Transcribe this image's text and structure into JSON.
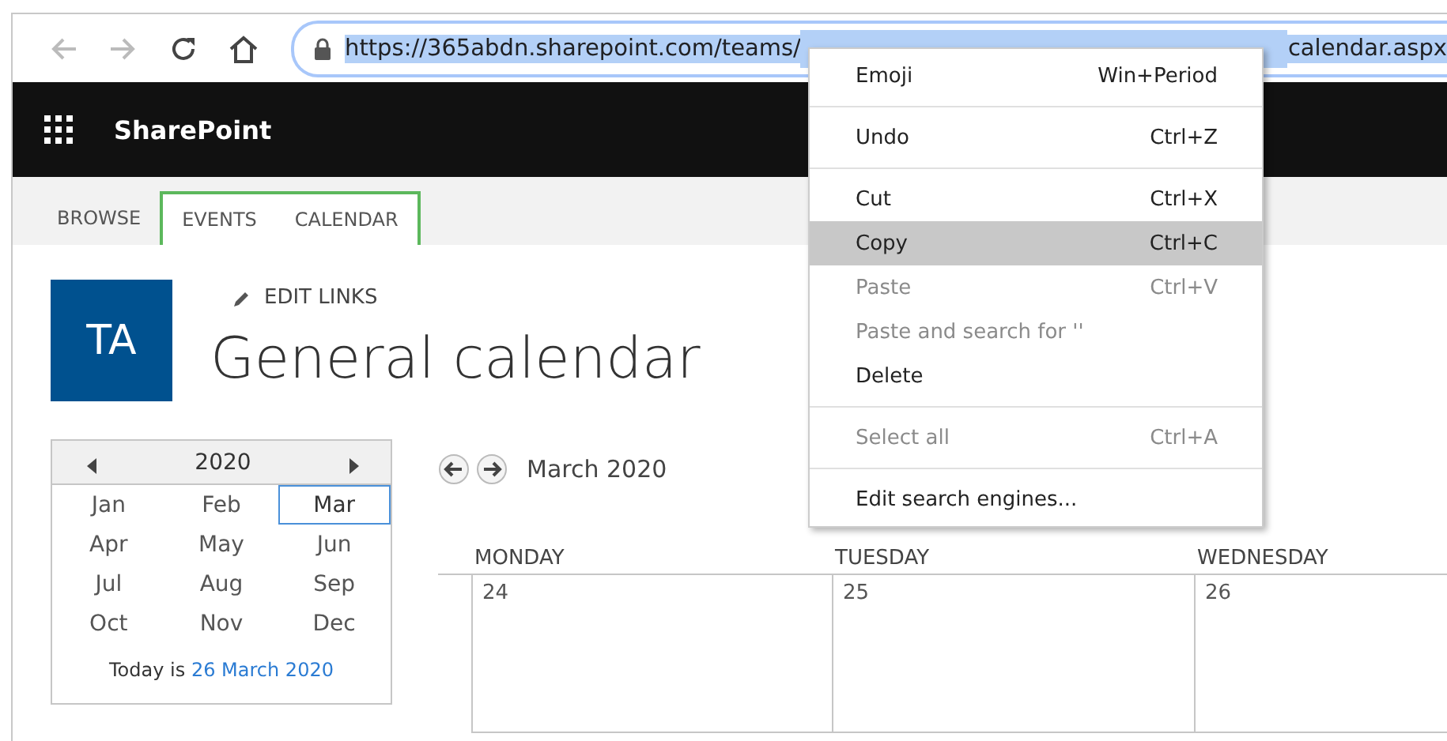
{
  "browser": {
    "url_start": "https://365abdn.sharepoint.com/teams/",
    "url_end": "calendar.aspx"
  },
  "suite_bar": {
    "title": "SharePoint"
  },
  "ribbon_tabs": [
    {
      "label": "BROWSE",
      "selected": false
    },
    {
      "label": "EVENTS",
      "selected": false
    },
    {
      "label": "CALENDAR",
      "selected": false
    }
  ],
  "site": {
    "logo": "TA",
    "edit_links": "EDIT LINKS",
    "title": "General calendar"
  },
  "mini_calendar": {
    "year": "2020",
    "months": [
      {
        "label": "Jan",
        "selected": false
      },
      {
        "label": "Feb",
        "selected": false
      },
      {
        "label": "Mar",
        "selected": true
      },
      {
        "label": "Apr",
        "selected": false
      },
      {
        "label": "May",
        "selected": false
      },
      {
        "label": "Jun",
        "selected": false
      },
      {
        "label": "Jul",
        "selected": false
      },
      {
        "label": "Aug",
        "selected": false
      },
      {
        "label": "Sep",
        "selected": false
      },
      {
        "label": "Oct",
        "selected": false
      },
      {
        "label": "Nov",
        "selected": false
      },
      {
        "label": "Dec",
        "selected": false
      }
    ],
    "today_label": "Today is",
    "today_link": "26 March 2020"
  },
  "calendar": {
    "period": "March 2020",
    "days": [
      {
        "name": "MONDAY",
        "date": "24"
      },
      {
        "name": "TUESDAY",
        "date": "25"
      },
      {
        "name": "WEDNESDAY",
        "date": "26"
      }
    ]
  },
  "context_menu": [
    {
      "kind": "item",
      "label": "Emoji",
      "shortcut": "Win+Period",
      "disabled": false,
      "selected": false
    },
    {
      "kind": "separator"
    },
    {
      "kind": "item",
      "label": "Undo",
      "shortcut": "Ctrl+Z",
      "disabled": false,
      "selected": false
    },
    {
      "kind": "separator"
    },
    {
      "kind": "item",
      "label": "Cut",
      "shortcut": "Ctrl+X",
      "disabled": false,
      "selected": false
    },
    {
      "kind": "item",
      "label": "Copy",
      "shortcut": "Ctrl+C",
      "disabled": false,
      "selected": true
    },
    {
      "kind": "item",
      "label": "Paste",
      "shortcut": "Ctrl+V",
      "disabled": true,
      "selected": false
    },
    {
      "kind": "item",
      "label": "Paste and search for ''",
      "disabled": true,
      "selected": false
    },
    {
      "kind": "item",
      "label": "Delete",
      "disabled": false,
      "selected": false
    },
    {
      "kind": "separator"
    },
    {
      "kind": "item",
      "label": "Select all",
      "shortcut": "Ctrl+A",
      "disabled": true,
      "selected": false
    },
    {
      "kind": "separator"
    },
    {
      "kind": "item",
      "label": "Edit search engines...",
      "disabled": false,
      "selected": false
    }
  ]
}
